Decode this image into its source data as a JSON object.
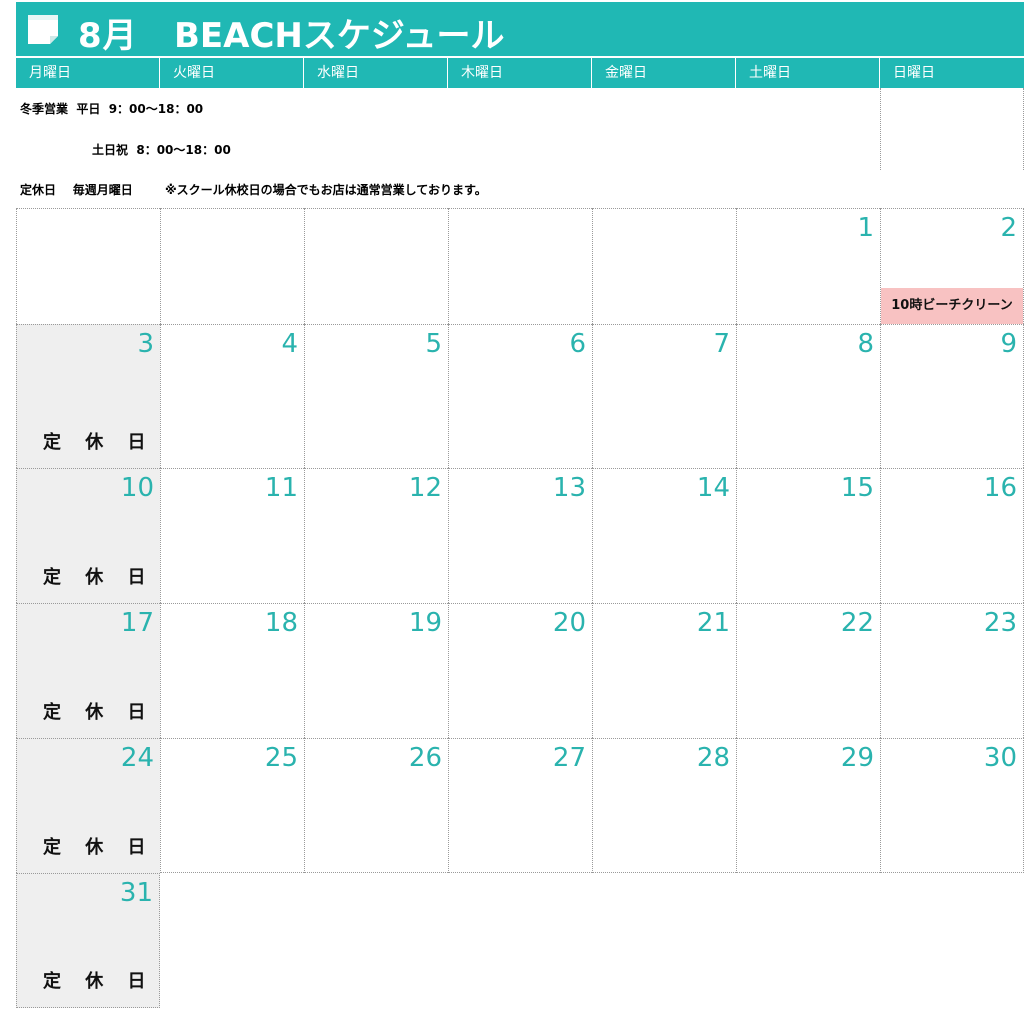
{
  "title": {
    "month": "8月",
    "text": "BEACHスケジュール",
    "icon": "note-icon"
  },
  "colors": {
    "accent": "#20b8b4",
    "day_number": "#2ab3ae",
    "closed_bg": "#efefef",
    "event_bg": "#f8c2c2"
  },
  "weekdays": [
    "月曜日",
    "火曜日",
    "水曜日",
    "木曜日",
    "金曜日",
    "土曜日",
    "日曜日"
  ],
  "info": {
    "hours_weekday": "冬季営業  平日  9：00～18：00",
    "hours_weekend": "土日祝  8：00～18：00",
    "closed_day": "定休日    毎週月曜日",
    "note": "※スクール休校日の場合でもお店は通常営業しております。"
  },
  "closed_label": "定 休 日",
  "event": {
    "day": 2,
    "label": "10時ビーチクリーン"
  },
  "weeks": [
    [
      "",
      "",
      "",
      "",
      "",
      "1",
      "2"
    ],
    [
      "3",
      "4",
      "5",
      "6",
      "7",
      "8",
      "9"
    ],
    [
      "10",
      "11",
      "12",
      "13",
      "14",
      "15",
      "16"
    ],
    [
      "17",
      "18",
      "19",
      "20",
      "21",
      "22",
      "23"
    ],
    [
      "24",
      "25",
      "26",
      "27",
      "28",
      "29",
      "30"
    ],
    [
      "31",
      "",
      "",
      "",
      "",
      "",
      ""
    ]
  ]
}
